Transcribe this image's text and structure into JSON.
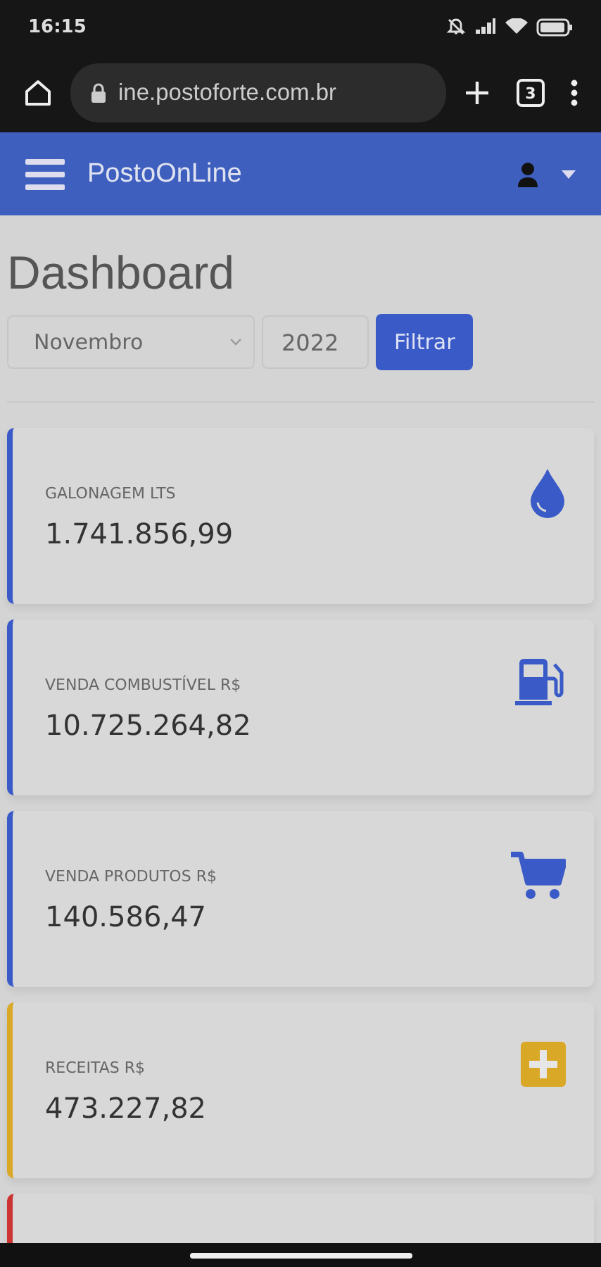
{
  "status_bar": {
    "time": "16:15"
  },
  "browser": {
    "url": "ine.postoforte.com.br",
    "tab_count": "3"
  },
  "header": {
    "title": "PostoOnLine"
  },
  "page": {
    "title": "Dashboard",
    "month": "Novembro",
    "year": "2022",
    "filter_button": "Filtrar"
  },
  "cards": [
    {
      "label": "GALONAGEM LTS",
      "value": "1.741.856,99",
      "color": "#3a5bc7",
      "kind": "drop"
    },
    {
      "label": "VENDA COMBUSTÍVEL R$",
      "value": "10.725.264,82",
      "color": "#3a5bc7",
      "kind": "pump"
    },
    {
      "label": "VENDA PRODUTOS R$",
      "value": "140.586,47",
      "color": "#3a5bc7",
      "kind": "cart"
    },
    {
      "label": "RECEITAS R$",
      "value": "473.227,82",
      "color": "#d9a826",
      "kind": "plus"
    },
    {
      "color": "#cc3333"
    }
  ]
}
